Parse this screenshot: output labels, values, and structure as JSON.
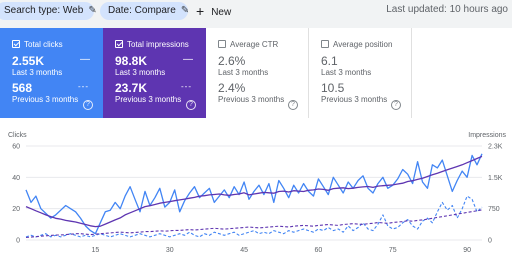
{
  "topbar": {
    "search_type_label": "Search type: Web",
    "date_label": "Date: Compare",
    "new_label": "New",
    "last_updated": "Last updated: 10 hours ago"
  },
  "cards": [
    {
      "key": "clicks",
      "label": "Total clicks",
      "checked": true,
      "value": "2.55K",
      "value_sub": "Last 3 months",
      "prev": "568",
      "prev_sub": "Previous 3 months",
      "color": "#4285f4"
    },
    {
      "key": "impressions",
      "label": "Total impressions",
      "checked": true,
      "value": "98.8K",
      "value_sub": "Last 3 months",
      "prev": "23.7K",
      "prev_sub": "Previous 3 months",
      "color": "#5e35b1"
    },
    {
      "key": "ctr",
      "label": "Average CTR",
      "checked": false,
      "value": "2.6%",
      "value_sub": "Last 3 months",
      "prev": "2.4%",
      "prev_sub": "Previous 3 months"
    },
    {
      "key": "position",
      "label": "Average position",
      "checked": false,
      "value": "6.1",
      "value_sub": "Last 3 months",
      "prev": "10.5",
      "prev_sub": "Previous 3 months"
    }
  ],
  "chart_data": {
    "type": "line",
    "left_axis_label": "Clicks",
    "right_axis_label": "Impressions",
    "left_ylim": [
      0,
      60
    ],
    "left_ticks": [
      "60",
      "40",
      "20",
      "0"
    ],
    "right_ylim": [
      0,
      2250
    ],
    "right_ticks": [
      "2.3K",
      "1.5K",
      "750",
      "0"
    ],
    "x_ticks": [
      "15",
      "30",
      "45",
      "60",
      "75",
      "90"
    ],
    "xlim": [
      1,
      93
    ],
    "series": [
      {
        "axis": "left",
        "style": "solid",
        "color": "#4285f4",
        "values": [
          32,
          24,
          28,
          20,
          17,
          14,
          16,
          19,
          22,
          20,
          18,
          14,
          9,
          6,
          4,
          11,
          18,
          19,
          24,
          20,
          28,
          34,
          26,
          18,
          31,
          22,
          27,
          33,
          21,
          24,
          32,
          18,
          25,
          30,
          34,
          27,
          30,
          33,
          24,
          28,
          32,
          27,
          34,
          29,
          37,
          26,
          31,
          35,
          29,
          36,
          24,
          38,
          33,
          27,
          35,
          30,
          36,
          31,
          28,
          39,
          34,
          29,
          40,
          35,
          30,
          37,
          33,
          38,
          41,
          33,
          30,
          36,
          40,
          33,
          35,
          39,
          45,
          42,
          36,
          50,
          37,
          33,
          48,
          46,
          51,
          41,
          31,
          38,
          44,
          40,
          54,
          48,
          55
        ]
      },
      {
        "axis": "right",
        "style": "solid",
        "color": "#5e35b1",
        "values": [
          800,
          750,
          700,
          650,
          600,
          560,
          520,
          500,
          470,
          450,
          430,
          400,
          370,
          340,
          320,
          330,
          380,
          430,
          480,
          530,
          600,
          650,
          700,
          750,
          800,
          820,
          850,
          880,
          900,
          920,
          940,
          960,
          980,
          1000,
          1020,
          1050,
          1060,
          1080,
          1090,
          1100,
          1080,
          1070,
          1090,
          1100,
          1130,
          1080,
          1100,
          1120,
          1140,
          1130,
          1120,
          1160,
          1170,
          1150,
          1180,
          1170,
          1160,
          1190,
          1200,
          1220,
          1210,
          1190,
          1230,
          1240,
          1250,
          1230,
          1240,
          1260,
          1270,
          1280,
          1260,
          1290,
          1300,
          1310,
          1320,
          1340,
          1360,
          1400,
          1420,
          1450,
          1480,
          1520,
          1560,
          1600,
          1640,
          1680,
          1720,
          1760,
          1800,
          1850,
          1900,
          1950,
          2000
        ]
      },
      {
        "axis": "left",
        "style": "dashed",
        "color": "#4285f4",
        "values": [
          2,
          3,
          2,
          3,
          4,
          2,
          3,
          2,
          3,
          4,
          3,
          2,
          3,
          2,
          3,
          4,
          3,
          2,
          3,
          4,
          3,
          2,
          3,
          4,
          3,
          2,
          3,
          4,
          3,
          2,
          3,
          4,
          3,
          5,
          3,
          2,
          4,
          3,
          5,
          4,
          3,
          4,
          5,
          3,
          4,
          5,
          6,
          4,
          5,
          4,
          6,
          5,
          4,
          6,
          5,
          6,
          7,
          6,
          5,
          7,
          6,
          8,
          6,
          7,
          5,
          9,
          6,
          8,
          11,
          7,
          6,
          10,
          16,
          9,
          7,
          8,
          11,
          13,
          9,
          7,
          12,
          14,
          11,
          18,
          24,
          19,
          22,
          14,
          20,
          28,
          26,
          18,
          21
        ]
      },
      {
        "axis": "right",
        "style": "dashed",
        "color": "#5e35b1",
        "values": [
          60,
          70,
          80,
          90,
          100,
          110,
          120,
          120,
          130,
          140,
          150,
          150,
          140,
          130,
          140,
          150,
          160,
          170,
          180,
          190,
          180,
          170,
          180,
          190,
          200,
          200,
          210,
          220,
          210,
          220,
          230,
          230,
          240,
          250,
          240,
          250,
          260,
          270,
          280,
          270,
          260,
          270,
          280,
          290,
          300,
          310,
          300,
          290,
          300,
          310,
          320,
          330,
          320,
          310,
          330,
          340,
          350,
          340,
          330,
          350,
          360,
          370,
          360,
          350,
          370,
          380,
          390,
          380,
          370,
          390,
          400,
          420,
          410,
          400,
          420,
          430,
          440,
          460,
          450,
          470,
          480,
          500,
          520,
          540,
          560,
          580,
          600,
          620,
          640,
          660,
          680,
          700,
          720
        ]
      }
    ]
  }
}
